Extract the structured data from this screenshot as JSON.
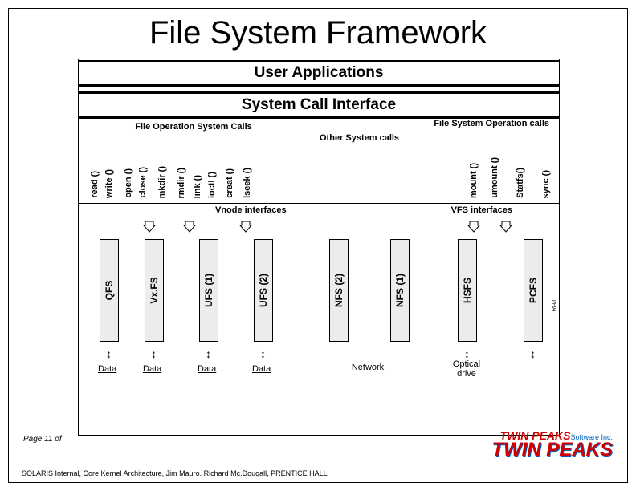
{
  "title": "File System Framework",
  "banners": {
    "user_apps": "User Applications",
    "syscall_if": "System Call Interface"
  },
  "labels": {
    "file_op_sys_calls": "File Operation System Calls",
    "file_sys_op_calls": "File System Operation calls",
    "other_sys_calls": "Other System calls",
    "vnode_if": "Vnode interfaces",
    "vfs_if": "VFS interfaces"
  },
  "file_calls": [
    "read ()",
    "write ()",
    "open ()",
    "close ()",
    "mkdir ()",
    "rmdir ()",
    "link ()",
    "ioctl ()",
    "creat ()",
    "lseek ()"
  ],
  "fs_calls": [
    "mount ()",
    "umount ()",
    "Statfs()",
    "sync ()"
  ],
  "filesystems": [
    "QFS",
    "Vx.FS",
    "UFS (1)",
    "UFS (2)",
    "NFS (2)",
    "NFS (1)",
    "HSFS",
    "PCFS"
  ],
  "storage": {
    "data": "Data",
    "network": "Network",
    "optical": "Optical drive"
  },
  "page": "Page 11 of",
  "footer": "SOLARIS Internal, Core Kernel Architecture, Jim Mauro. Richard Mc.Dougall, PRENTICE HALL",
  "brand": {
    "line1a": "TWIN PEAKS",
    "line1b": "Software Inc.",
    "line2": "TWIN PEAKS"
  },
  "side": "PF94"
}
